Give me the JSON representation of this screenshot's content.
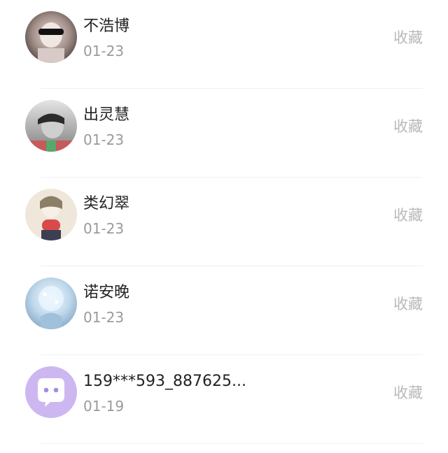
{
  "contacts": [
    {
      "name": "不浩博",
      "date": "01-23",
      "action": "收藏",
      "avatar": "photo-boy-sunglasses",
      "colors": {
        "bg": "#5a4c47",
        "accent": "#111111"
      }
    },
    {
      "name": "出灵慧",
      "date": "01-23",
      "action": "收藏",
      "avatar": "photo-grayscale-portrait",
      "colors": {
        "bg": "#b5b5b5",
        "accent": "#d36b6b"
      }
    },
    {
      "name": "类幻翠",
      "date": "01-23",
      "action": "收藏",
      "avatar": "photo-illustrated-figure",
      "colors": {
        "bg": "#eee7d9",
        "accent": "#d94b4b"
      }
    },
    {
      "name": "诺安晚",
      "date": "01-23",
      "action": "收藏",
      "avatar": "photo-crystal-ball",
      "colors": {
        "bg": "#d6e7f2",
        "accent": "#94b9d6"
      }
    },
    {
      "name": "159***593_887625...",
      "date": "01-19",
      "action": "收藏",
      "avatar": "default-chat-icon",
      "colors": {
        "bg": "#cdb7f1",
        "accent": "#8a62d6"
      }
    }
  ]
}
